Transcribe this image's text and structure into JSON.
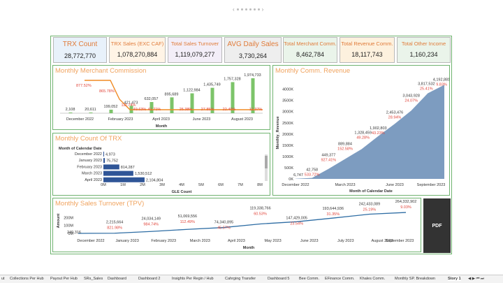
{
  "pager": {
    "prev": "‹",
    "next": "›"
  },
  "kpis": [
    {
      "title": "TRX Count",
      "value": "28,772,770",
      "bg": "#e8f1fa",
      "color": "#e07b39"
    },
    {
      "title": "TRX Sales (EXC CAF)",
      "value": "1,078,270,884",
      "bg": "#fff4e6",
      "color": "#e07b39"
    },
    {
      "title": "Total Sales Turnover",
      "value": "1,119,079,277",
      "bg": "#f3eef8",
      "color": "#e07b39"
    },
    {
      "title": "AVG Daily Sales",
      "value": "3,730,264",
      "bg": "#eeeeee",
      "color": "#e07b39"
    },
    {
      "title": "Total Merchant Comm.",
      "value": "8,462,784",
      "bg": "#eaf4ea",
      "color": "#e07b39"
    },
    {
      "title": "Total Revenue Comm.",
      "value": "18,117,743",
      "bg": "#fdf1de",
      "color": "#e07b39"
    },
    {
      "title": "Total Other Income",
      "value": "1,160,234",
      "bg": "#eaf4ea",
      "color": "#e07b39"
    }
  ],
  "panels": {
    "merchant": {
      "title": "Monthly Merchant Commission"
    },
    "count": {
      "title": "Monthly Count Of TRX"
    },
    "revenue": {
      "title": "Monthly Comm. Revenue"
    },
    "turnover": {
      "title": "Monthly Sales Turnover (TPV)"
    }
  },
  "pdf_label": "PDF",
  "tabs": [
    {
      "label": "ut",
      "active": false
    },
    {
      "label": "Collections Per Hub",
      "active": false
    },
    {
      "label": "Payout Per Hub",
      "active": false
    },
    {
      "label": "SRs_Sales",
      "active": false
    },
    {
      "label": "Dashboard",
      "active": false
    },
    {
      "label": "Dashboard 2",
      "active": false
    },
    {
      "label": "Insights Per Regin / Hub",
      "active": false
    },
    {
      "label": "Cahrging Transfer",
      "active": false
    },
    {
      "label": "Dashboard 5",
      "active": false
    },
    {
      "label": "Bee Comm.",
      "active": false
    },
    {
      "label": "EFinance Comm.",
      "active": false
    },
    {
      "label": "Khales Comm.",
      "active": false
    },
    {
      "label": "Monthly SP. Breakdown",
      "active": false
    },
    {
      "label": "Story 1",
      "active": true
    }
  ],
  "chart_data": [
    {
      "type": "bar",
      "title": "Monthly Merchant Commission",
      "xlabel": "Month",
      "categories": [
        "December 2022",
        "January 2023",
        "February 2023",
        "March 2023",
        "April 2023",
        "May 2023",
        "June 2023",
        "July 2023",
        "August 2023",
        "September 2023"
      ],
      "tick_labels": [
        "December 2022",
        "February 2023",
        "April 2023",
        "June 2023",
        "August 2023"
      ],
      "values": [
        2108,
        20611,
        199052,
        421473,
        632057,
        895689,
        1122984,
        1435749,
        1757328,
        1974733
      ],
      "value_labels": [
        "2,108",
        "20,611",
        "199,052",
        "421,473",
        "632,057",
        "895,689",
        "1,122,984",
        "1,435,749",
        "1,757,328",
        "1,974,733"
      ],
      "growth_labels": [
        "",
        "877.52%",
        "865.78%",
        "",
        "",
        "",
        "",
        "",
        "",
        ""
      ],
      "overlay_labels": [
        "111.74%",
        "49.63%",
        "41.71%",
        "25.38%",
        "27.85%",
        "22.40%",
        "12.37%"
      ],
      "bar_color": "#7cc46a",
      "line_color": "#f08a24"
    },
    {
      "type": "bar",
      "orientation": "horizontal",
      "title": "Monthly Count Of TRX",
      "group_label": "Month of Calendar Date",
      "xlabel": "GLE Count",
      "categories": [
        "December 2022",
        "January 2023",
        "February 2023",
        "March 2023",
        "April 2023"
      ],
      "values": [
        4973,
        75752,
        814287,
        1530512,
        2104804
      ],
      "value_labels": [
        "4,973",
        "75,752",
        "814,287",
        "1,530,512",
        "2,104,804"
      ],
      "xticks": [
        "0M",
        "1M",
        "2M",
        "3M",
        "4M",
        "5M",
        "6M",
        "7M",
        "8M"
      ],
      "xlim": [
        0,
        8000000
      ],
      "bar_color": "#2f5597"
    },
    {
      "type": "area",
      "title": "Monthly Comm. Revenue",
      "xlabel": "Month of Calendar Date",
      "ylabel": "Monthly_Revenue",
      "categories": [
        "December 2022",
        "January 2023",
        "February 2023",
        "March 2023",
        "April 2023",
        "May 2023",
        "June 2023",
        "July 2023",
        "August 2023",
        "September 2023"
      ],
      "tick_labels": [
        "December 2022",
        "March 2023",
        "June 2023",
        "September 2023"
      ],
      "values": [
        6747,
        42758,
        449377,
        889884,
        1328459,
        1902803,
        2453476,
        3043928,
        3817532,
        4192881
      ],
      "value_labels": [
        "6,747",
        "42,758",
        "449,377",
        "889,884",
        "1,328,459",
        "1,902,803",
        "2,453,476",
        "3,043,928",
        "3,817,532",
        "4,192,881"
      ],
      "growth_labels": [
        "",
        "533.72%",
        "927.41%",
        "152.58%",
        "49.28%",
        "43.23%",
        "28.94%",
        "24.07%",
        "25.41%",
        "9.83%"
      ],
      "yticks": [
        "0K",
        "500K",
        "1000K",
        "1500K",
        "2000K",
        "2500K",
        "3000K",
        "3500K",
        "4000K"
      ],
      "ylim": [
        0,
        4300000
      ],
      "fill_color": "#7d9cc0"
    },
    {
      "type": "line",
      "title": "Monthly Sales Turnover (TPV)",
      "xlabel": "Month",
      "ylabel": "Amount",
      "categories": [
        "December 2022",
        "January 2023",
        "February 2023",
        "March 2023",
        "April 2023",
        "May 2023",
        "June 2023",
        "July 2023",
        "August 2023",
        "September 2023"
      ],
      "values": [
        240316,
        2215664,
        24034149,
        51069556,
        74340895,
        119338766,
        147429005,
        193644936,
        242433089,
        264332902
      ],
      "value_labels": [
        "240,316",
        "2,215,664",
        "24,034,149",
        "51,069,556",
        "74,340,895",
        "119,338,766",
        "147,429,005",
        "193,644,936",
        "242,433,089",
        "264,332,902"
      ],
      "growth_labels": [
        "",
        "821.98%",
        "984.74%",
        "112.49%",
        "45.57%",
        "60.53%",
        "23.54%",
        "31.35%",
        "25.19%",
        "9.03%"
      ],
      "yticks": [
        "0M",
        "100M",
        "200M"
      ],
      "ylim": [
        0,
        300000000
      ],
      "line_color": "#2e6da4"
    }
  ]
}
